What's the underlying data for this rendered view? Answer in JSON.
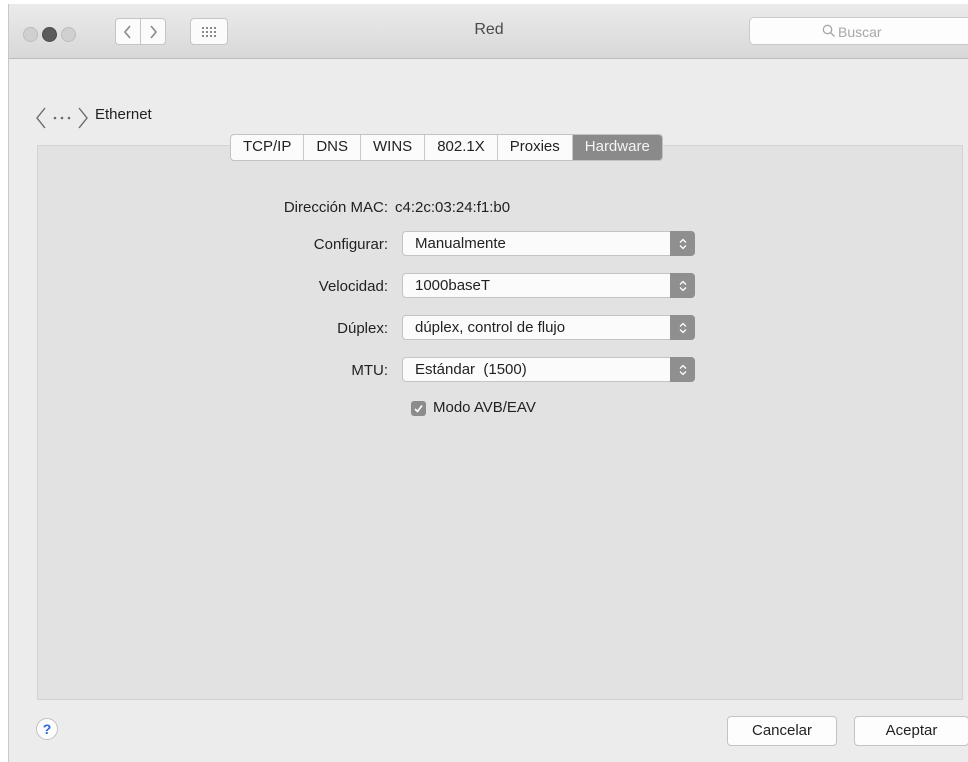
{
  "window": {
    "title": "Red"
  },
  "toolbar": {
    "back_icon": "chevron-left-icon",
    "forward_icon": "chevron-right-icon",
    "grid_icon": "grid-icon",
    "search_placeholder": "Buscar"
  },
  "interface": {
    "name": "Ethernet",
    "icon": "ethernet-icon"
  },
  "tabs": [
    {
      "label": "TCP/IP",
      "active": false
    },
    {
      "label": "DNS",
      "active": false
    },
    {
      "label": "WINS",
      "active": false
    },
    {
      "label": "802.1X",
      "active": false
    },
    {
      "label": "Proxies",
      "active": false
    },
    {
      "label": "Hardware",
      "active": true
    }
  ],
  "hardware": {
    "mac_label": "Dirección MAC:",
    "mac_value": "c4:2c:03:24:f1:b0",
    "configure": {
      "label": "Configurar:",
      "value": "Manualmente"
    },
    "speed": {
      "label": "Velocidad:",
      "value": "1000baseT"
    },
    "duplex": {
      "label": "Dúplex:",
      "value": "dúplex, control de flujo"
    },
    "mtu": {
      "label": "MTU:",
      "value": "Estándar  (1500)"
    },
    "avb": {
      "label": "Modo AVB/EAV",
      "checked": true
    }
  },
  "footer": {
    "help_label": "?",
    "cancel_label": "Cancelar",
    "ok_label": "Aceptar"
  },
  "colors": {
    "active_tab": "#8a8a8a",
    "help_icon": "#2a64e0"
  }
}
